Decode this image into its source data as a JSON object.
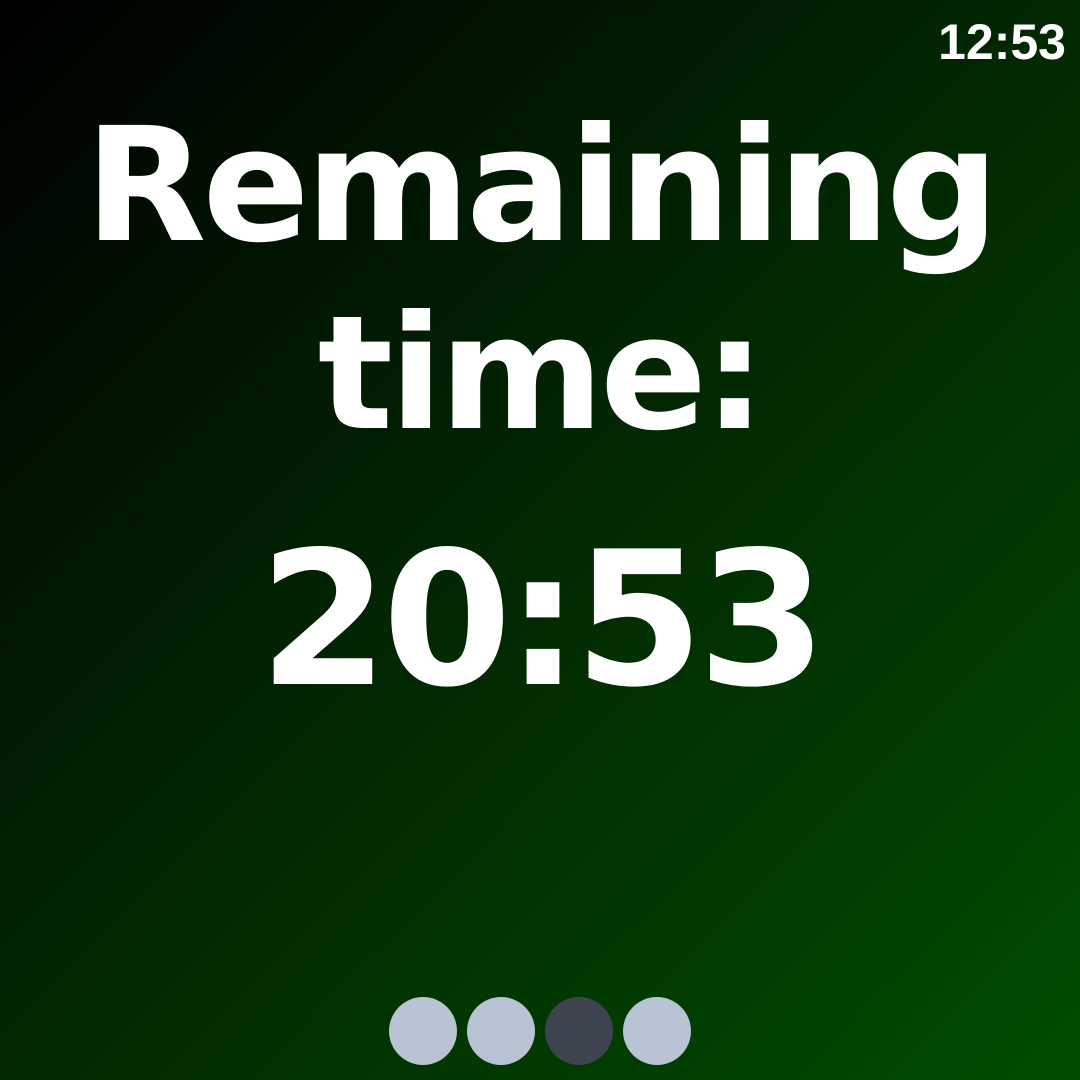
{
  "status_bar": {
    "clock": "12:53"
  },
  "timer": {
    "title_line1": "Remaining",
    "title_line2": "time:",
    "remaining": "20:53"
  },
  "pager": {
    "count": 4,
    "active_index": 2,
    "colors": {
      "inactive": "#b8c4d4",
      "active": "#3d4450"
    }
  },
  "colors": {
    "background_start": "#000000",
    "background_end": "#004d00",
    "text": "#ffffff"
  }
}
